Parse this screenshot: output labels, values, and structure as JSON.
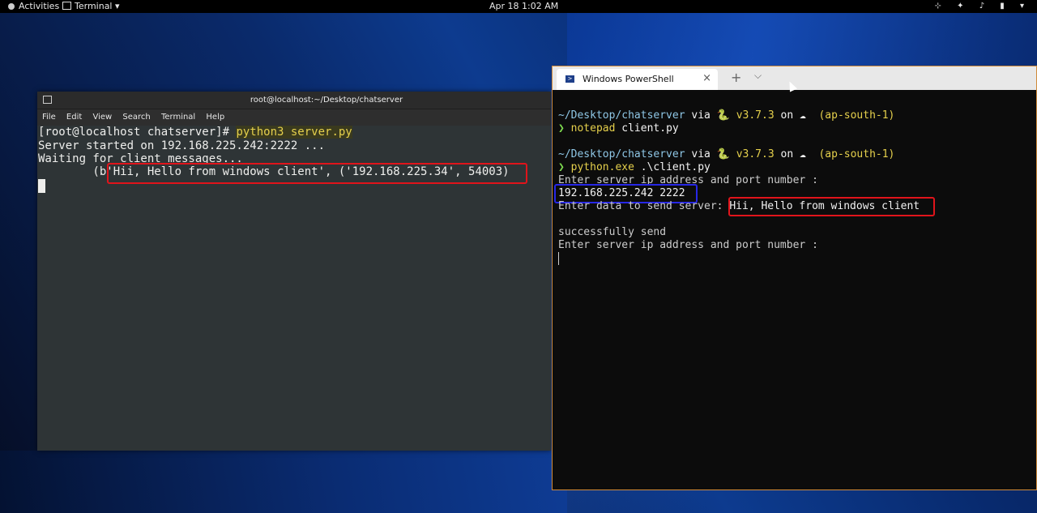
{
  "topbar": {
    "activities": "Activities",
    "app_menu": "Terminal ▾",
    "clock": "Apr 18  1:02 AM",
    "tray_icons": [
      "network-icon",
      "accessibility-icon",
      "volume-icon",
      "battery-icon",
      "power-menu-icon"
    ],
    "tray_glyphs": "⊹ ✦ ♪ ▮ ▾"
  },
  "gnome_terminal": {
    "title": "root@localhost:~/Desktop/chatserver",
    "menu": [
      "File",
      "Edit",
      "View",
      "Search",
      "Terminal",
      "Help"
    ],
    "lines": {
      "prompt": "[root@localhost chatserver]# ",
      "command": "python3 server.py",
      "started": "Server started on 192.168.225.242:2222 ...",
      "waiting": "Waiting for client messages...",
      "message": "        (b'Hii, Hello from windows client', ('192.168.225.34', 54003)"
    }
  },
  "powershell": {
    "tab_label": "Windows PowerShell",
    "tab_close": "×",
    "new_tab": "+",
    "dropdown": "⌵",
    "prompt1": {
      "path": "~/Desktop/chatserver",
      "via": " via ",
      "python_icon": "🐍",
      "version": " v3.7.3",
      "on": " on ",
      "cloud_icon": "☁",
      "region": "  (ap-south-1)"
    },
    "cmd1_arrow": "❯ ",
    "cmd1_exe": "notepad",
    "cmd1_args": " client.py",
    "cmd2_exe": "python.exe",
    "cmd2_args": " .\\client.py",
    "enter_ip": "Enter server ip address and port number :",
    "ip_value": "192.168.225.242 2222",
    "enter_data_label": "Enter data to send server: ",
    "data_value": "Hii, Hello from windows client",
    "success": "successfully send",
    "enter_ip_again": "Enter server ip address and port number :"
  },
  "colors": {
    "highlight_red": "#e0141b",
    "highlight_blue": "#2727e6",
    "ps_border": "#d08a3a"
  }
}
